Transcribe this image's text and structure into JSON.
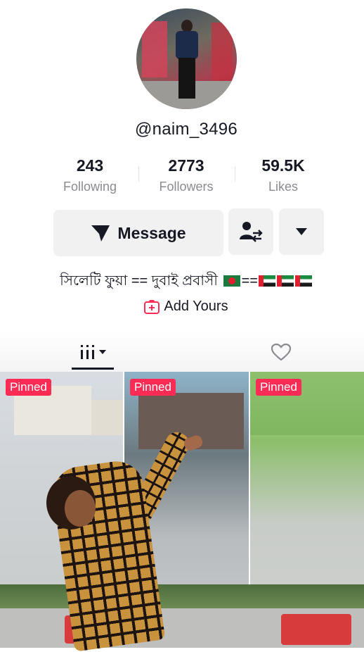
{
  "profile": {
    "username": "@naim_3496",
    "avatar_icon": "profile-avatar-photo"
  },
  "stats": [
    {
      "value": "243",
      "label": "Following"
    },
    {
      "value": "2773",
      "label": "Followers"
    },
    {
      "value": "59.5K",
      "label": "Likes"
    }
  ],
  "actions": {
    "message_label": "Message",
    "message_icon": "send-arrow-icon",
    "follow_icon": "person-swap-icon",
    "more_icon": "caret-down-icon"
  },
  "bio": {
    "text": "সিলেটি ফুয়া == দুবাই প্রবাসী",
    "separator": "==",
    "flags": [
      "bangladesh-flag",
      "uae-flag",
      "uae-flag",
      "uae-flag"
    ]
  },
  "add_yours": {
    "label": "Add Yours",
    "icon": "plus-box-icon"
  },
  "tabs": [
    {
      "name": "videos",
      "icon": "grid-icon"
    },
    {
      "name": "liked",
      "icon": "heart-outline-icon"
    }
  ],
  "videos": [
    {
      "badge": "Pinned"
    },
    {
      "badge": "Pinned"
    },
    {
      "badge": "Pinned"
    }
  ],
  "colors": {
    "accent": "#fe2c55",
    "text": "#161823",
    "muted": "#8a8b91",
    "button_bg": "#f1f1f2"
  }
}
